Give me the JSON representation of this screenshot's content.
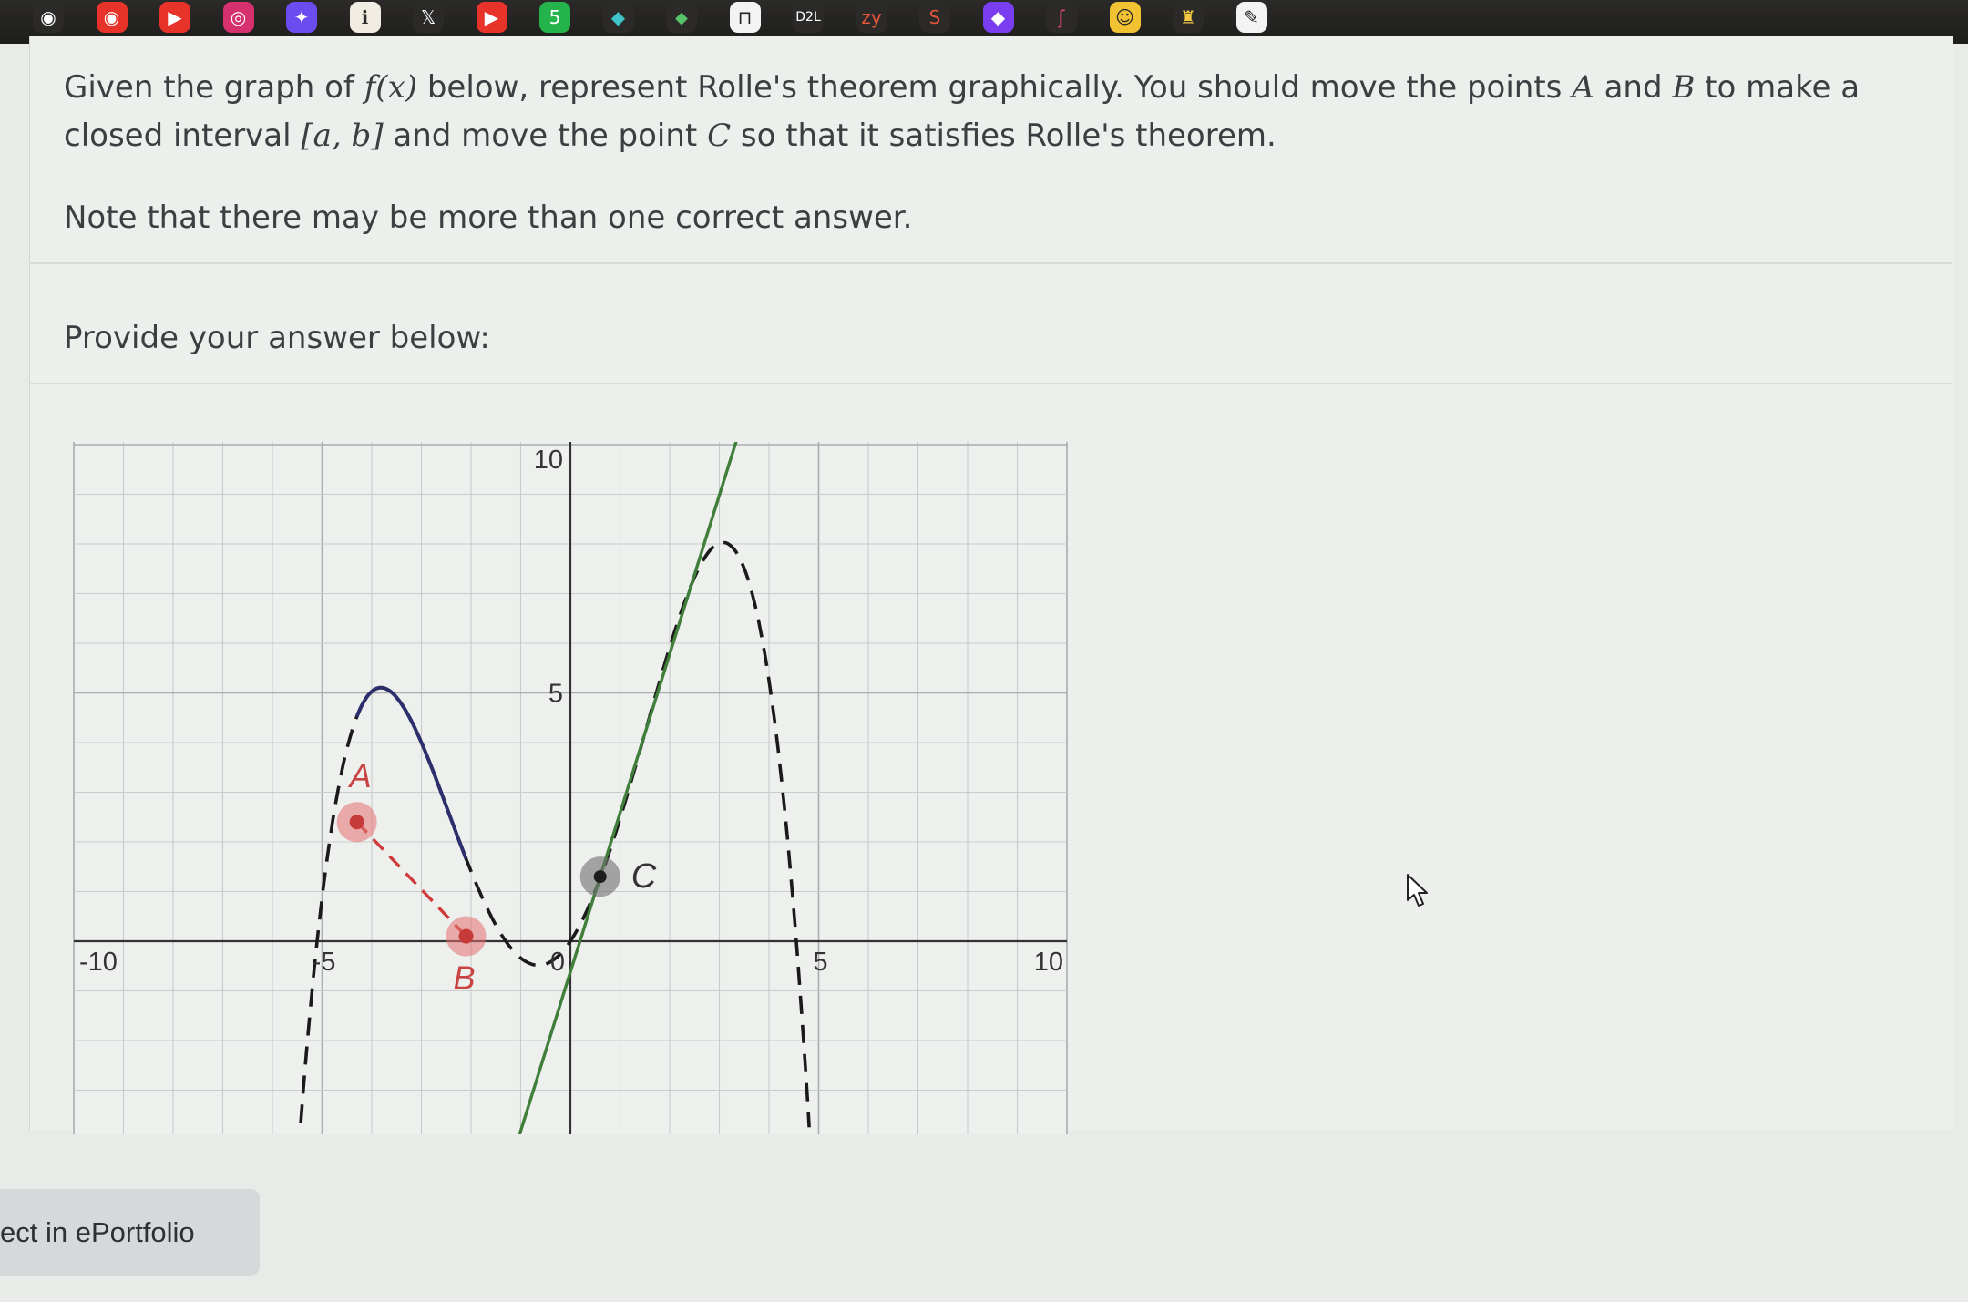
{
  "dock": {
    "icons": [
      {
        "name": "opera-icon",
        "glyph": "◉",
        "bg": "#2b2a28",
        "fg": "#ffffff"
      },
      {
        "name": "record-icon",
        "glyph": "◉",
        "bg": "#e8332a",
        "fg": "#ffffff"
      },
      {
        "name": "youtube-icon",
        "glyph": "▶",
        "bg": "#e8332a",
        "fg": "#ffffff"
      },
      {
        "name": "instagram-icon",
        "glyph": "◎",
        "bg": "#d6306e",
        "fg": "#ffffff"
      },
      {
        "name": "messenger-icon",
        "glyph": "✦",
        "bg": "#6a4cf0",
        "fg": "#ffffff"
      },
      {
        "name": "clipboard-icon",
        "glyph": "ℹ",
        "bg": "#f1ede3",
        "fg": "#2a2a2a"
      },
      {
        "name": "x-icon",
        "glyph": "𝕏",
        "bg": "#2b2a28",
        "fg": "#ffffff"
      },
      {
        "name": "youtube-red-icon",
        "glyph": "▶",
        "bg": "#e8332a",
        "fg": "#ffffff"
      },
      {
        "name": "whatsapp-icon",
        "glyph": "5",
        "bg": "#25b34b",
        "fg": "#ffffff"
      },
      {
        "name": "globe-icon",
        "glyph": "◆",
        "bg": "#2b2a28",
        "fg": "#3fc3c8"
      },
      {
        "name": "maps-icon",
        "glyph": "⬥",
        "bg": "#2b2a28",
        "fg": "#58c46a"
      },
      {
        "name": "window-icon",
        "glyph": "⊓",
        "bg": "#f3f3f3",
        "fg": "#222222"
      },
      {
        "name": "d2l-icon",
        "glyph": "D2L",
        "bg": "#2b2a28",
        "fg": "#ffffff"
      },
      {
        "name": "zybooks-icon",
        "glyph": "zy",
        "bg": "#2b2a28",
        "fg": "#e2553a"
      },
      {
        "name": "snake-icon",
        "glyph": "S",
        "bg": "#2b2a28",
        "fg": "#e2553a"
      },
      {
        "name": "diamond-icon",
        "glyph": "◆",
        "bg": "#7a3df0",
        "fg": "#ffffff"
      },
      {
        "name": "hook-icon",
        "glyph": "ʃ",
        "bg": "#2b2a28",
        "fg": "#e54a6c"
      },
      {
        "name": "emoji-icon",
        "glyph": "☺",
        "bg": "#f1c232",
        "fg": "#2b2a28"
      },
      {
        "name": "gift-icon",
        "glyph": "♜",
        "bg": "#2b2a28",
        "fg": "#f2c744"
      },
      {
        "name": "photo-icon",
        "glyph": "✎",
        "bg": "#f3f3f3",
        "fg": "#222222"
      }
    ]
  },
  "question": {
    "line1_pre": "Given the graph of ",
    "line1_fx": "f(x)",
    "line1_mid": " below, represent Rolle's theorem graphically. You should move the points ",
    "line1_A": "A",
    "line1_and": " and ",
    "line1_B": "B",
    "line1_post": " to make a",
    "line2_pre": "closed interval ",
    "line2_interval": "[a, b]",
    "line2_mid": " and move the point ",
    "line2_C": "C",
    "line2_post": " so that it satisfies Rolle's theorem.",
    "note": "Note that there may be more than one correct answer."
  },
  "answer": {
    "prompt": "Provide your answer below:"
  },
  "graph": {
    "x_tick_labels": [
      "-10",
      "-5",
      "0",
      "5",
      "10"
    ],
    "y_tick_labels": [
      "10",
      "5"
    ],
    "point_labels": {
      "A": "A",
      "B": "B",
      "C": "C"
    },
    "points": {
      "A": {
        "x": -4.3,
        "y": 2.4
      },
      "B": {
        "x": -2.1,
        "y": 0.1
      },
      "C": {
        "x": 0.6,
        "y": 1.3
      }
    },
    "colors": {
      "curve": "#1a1a1a",
      "selected_arc": "#2c2f6b",
      "secant": "#cf3b3b",
      "tangent": "#3f7f3a",
      "point_handle": "#e46f6f",
      "point_center": "#c73a3a",
      "c_handle": "#6e6e6e",
      "grid": "#c9cccc",
      "axis": "#333333"
    }
  },
  "footer": {
    "eportfolio_label": "ect in ePortfolio"
  }
}
